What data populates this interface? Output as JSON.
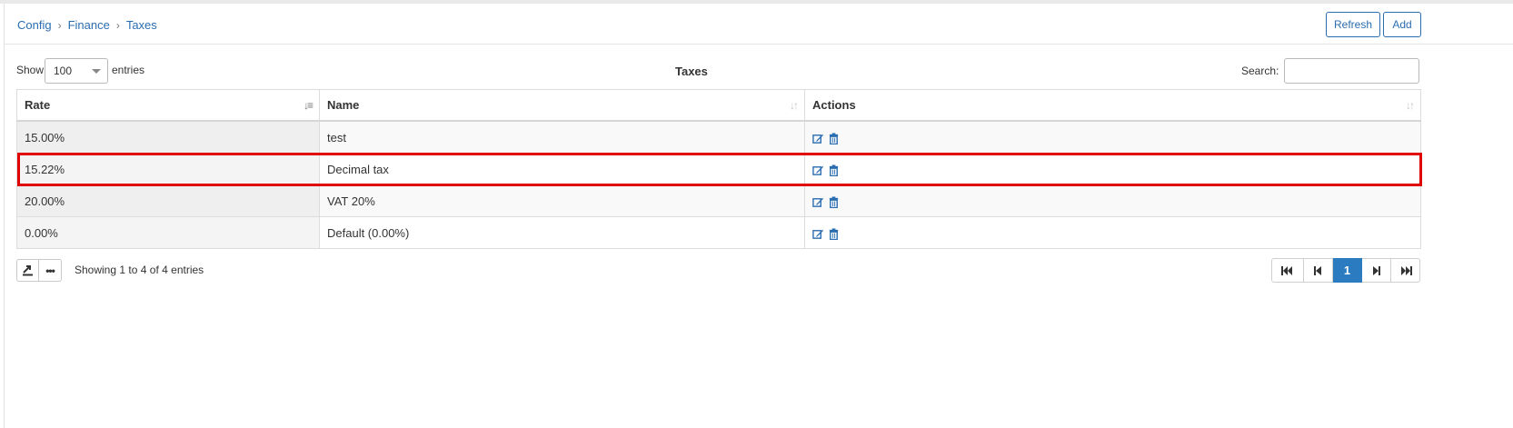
{
  "breadcrumb": [
    {
      "label": "Config"
    },
    {
      "label": "Finance"
    },
    {
      "label": "Taxes"
    }
  ],
  "header": {
    "refresh_label": "Refresh",
    "add_label": "Add"
  },
  "controls": {
    "show_label": "Show",
    "entries_label": "entries",
    "page_length": "100",
    "table_title": "Taxes",
    "search_label": "Search:",
    "search_value": ""
  },
  "table": {
    "columns": [
      {
        "label": "Rate",
        "sort": "active"
      },
      {
        "label": "Name",
        "sort": "none"
      },
      {
        "label": "Actions",
        "sort": "none"
      }
    ],
    "rows": [
      {
        "rate": "15.00%",
        "name": "test"
      },
      {
        "rate": "15.22%",
        "name": "Decimal tax",
        "highlighted": true
      },
      {
        "rate": "20.00%",
        "name": "VAT 20%"
      },
      {
        "rate": "0.00%",
        "name": "Default (0.00%)"
      }
    ],
    "row_actions": [
      "edit-icon",
      "delete-icon"
    ]
  },
  "footer": {
    "info_prefix": "Showing ",
    "info_from": "1",
    "info_mid1": " to ",
    "info_to": "4",
    "info_mid2": " of ",
    "info_total": "4",
    "info_suffix": " entries",
    "current_page": "1"
  },
  "colors": {
    "accent": "#2a6db0",
    "highlight": "#e00000",
    "page_active": "#2a7bbf"
  }
}
